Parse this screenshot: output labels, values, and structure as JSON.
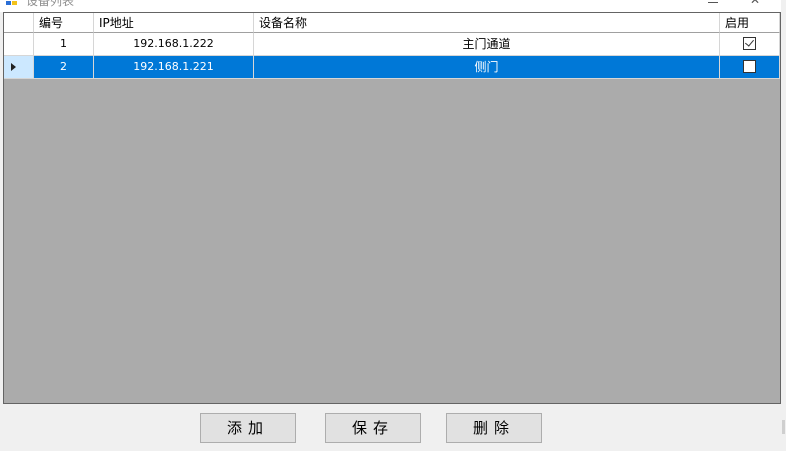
{
  "window": {
    "title": "设备列表"
  },
  "grid": {
    "columns": [
      "编号",
      "IP地址",
      "设备名称",
      "启用"
    ],
    "rows": [
      {
        "id": "1",
        "ip": "192.168.1.222",
        "name": "主门通道",
        "enabled": true,
        "selected": false
      },
      {
        "id": "2",
        "ip": "192.168.1.221",
        "name": "侧门",
        "enabled": false,
        "selected": true
      }
    ]
  },
  "buttons": {
    "add_label": "添加",
    "save_label": "保存",
    "delete_label": "删除"
  },
  "colors": {
    "selection": "#0078d7",
    "grid_background": "#ababab"
  }
}
